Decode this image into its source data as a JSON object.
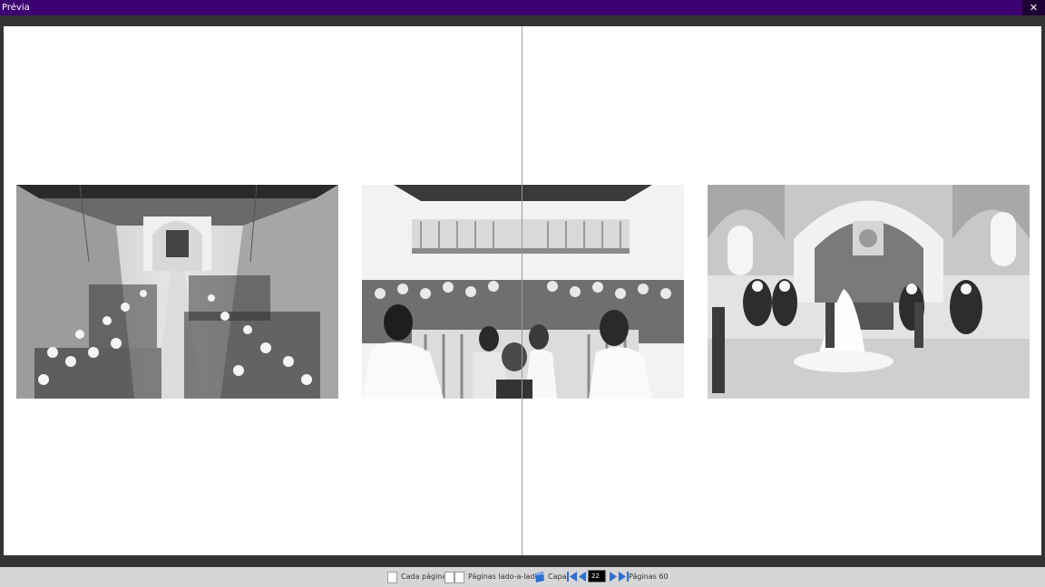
{
  "window": {
    "title": "Prévia",
    "close_label": "✕"
  },
  "toolbar": {
    "single_page_label": "Cada página",
    "side_by_side_label": "Páginas lado-a-lado",
    "cover_label": "Capa",
    "current_page": "22",
    "pages_prefix": "Páginas",
    "total_pages": "60"
  },
  "colors": {
    "titlebar": "#3d0070",
    "close_button": "#1d0035",
    "nav_icons": "#2e6fd0",
    "background": "#333333"
  },
  "icons": {
    "close": "close-icon",
    "single_page": "single-page-icon",
    "side_by_side": "side-by-side-pages-icon",
    "cover": "cover-icon",
    "first": "first-page-icon",
    "prev": "previous-page-icon",
    "next": "next-page-icon",
    "last": "last-page-icon"
  }
}
